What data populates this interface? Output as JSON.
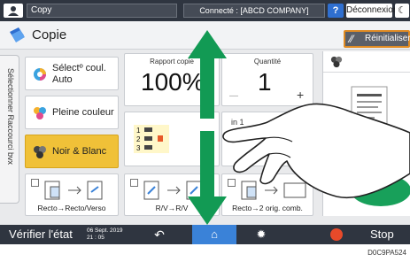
{
  "topbar": {
    "app_label": "Copy",
    "connection": "Connecté : [ABCD COMPANY]",
    "help_label": "?",
    "logout_label": "Déconnexion",
    "sleep_label": "☾"
  },
  "title": {
    "text": "Copie",
    "reset_label": "Réinitialiser"
  },
  "side_tab": {
    "label": "Sélectionner Raccourci bvx"
  },
  "modes": [
    {
      "label": "Sélectº coul. Auto"
    },
    {
      "label": "Pleine couleur"
    },
    {
      "label": "Noir & Blanc"
    }
  ],
  "tiles": {
    "ratio_caption": "Rapport copie",
    "ratio_value": "100%",
    "qty_caption": "Quantité",
    "qty_value": "1",
    "qty_minus": "—",
    "qty_plus": "+",
    "combine_caption": "in 1"
  },
  "functions": [
    {
      "label": "Recto→Recto/Verso"
    },
    {
      "label": "R/V→R/V"
    },
    {
      "label": "Recto→2 orig. comb."
    }
  ],
  "bottombar": {
    "check_status": "Vérifier l'état",
    "date": "06 Sept. 2019",
    "time": "21 : 05",
    "stop_label": "Stop"
  },
  "footer": {
    "code": "D0C9PA524"
  },
  "colors": {
    "active_mode": "#f0c138",
    "arrow_green": "#129a54",
    "home_blue": "#3a82d8",
    "reset_border": "#e08b23"
  }
}
